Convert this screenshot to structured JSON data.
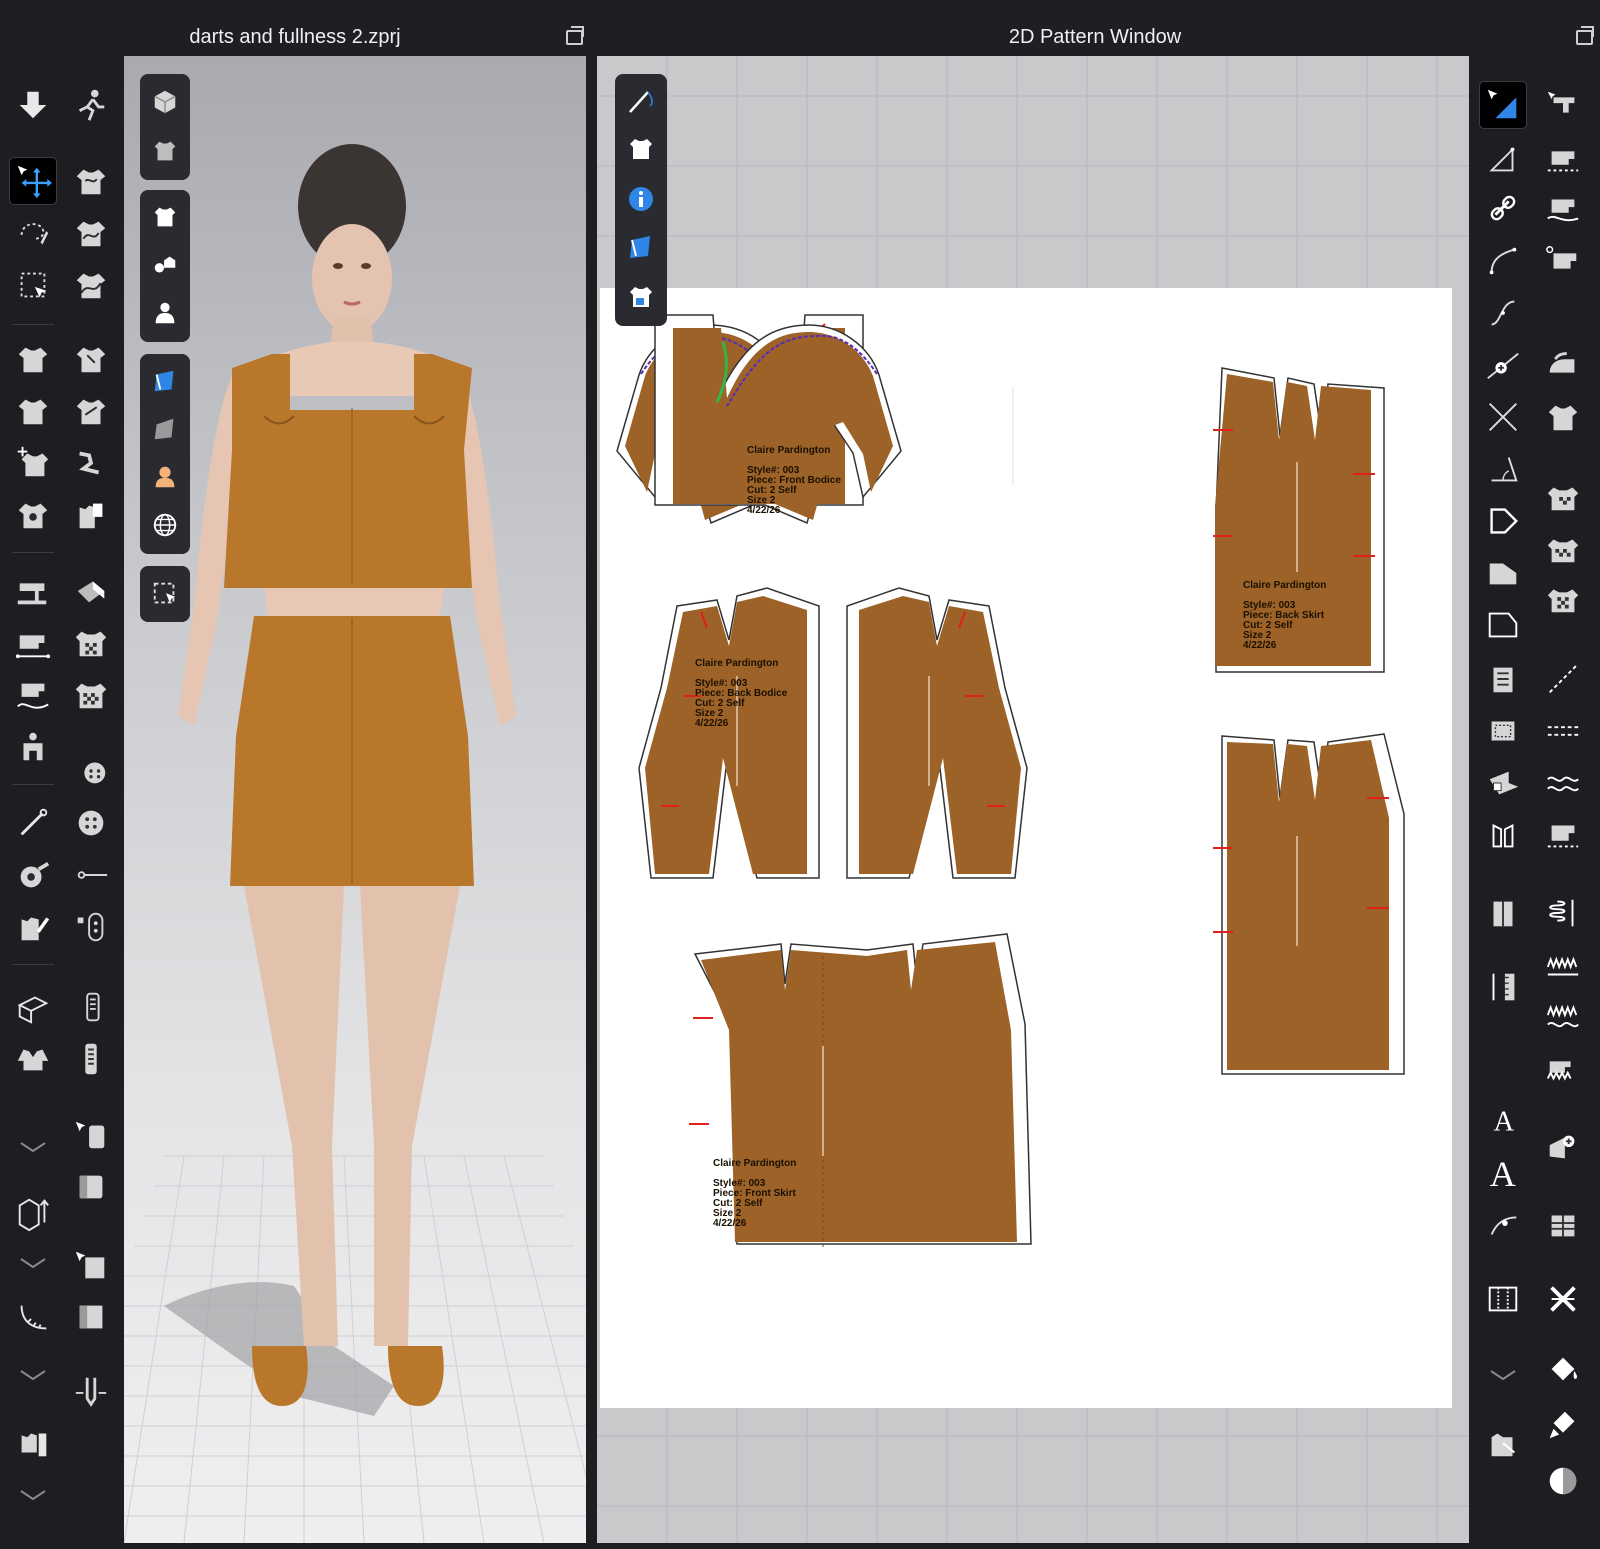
{
  "left_window": {
    "title": "darts and fullness 2.zprj"
  },
  "right_window": {
    "title": "2D Pattern Window"
  },
  "colors": {
    "fabric": "#9c6228",
    "fabric_3d": "#b9772c",
    "seam_purple": "#5a2bb5",
    "seam_green": "#2fb84a",
    "notch_red": "#e0201a",
    "accent_blue": "#2f86e6"
  },
  "patterns": [
    {
      "id": "front-bodice-left",
      "author": "",
      "style": "",
      "piece": "",
      "cut": "",
      "size": "",
      "date": ""
    },
    {
      "id": "front-bodice-right",
      "author": "Claire Pardington",
      "style": "Style#: 003",
      "piece": "Piece: Front Bodice",
      "cut": "Cut: 2 Self",
      "size": "Size 2",
      "date": "4/22/26"
    },
    {
      "id": "back-bodice-left",
      "author": "Claire Pardington",
      "style": "Style#: 003",
      "piece": "Piece: Back Bodice",
      "cut": "Cut: 2 Self",
      "size": "Size 2",
      "date": "4/22/26"
    },
    {
      "id": "back-skirt",
      "author": "Claire Pardington",
      "style": "Style#: 003",
      "piece": "Piece: Back Skirt",
      "cut": "Cut: 2 Self",
      "size": "Size 2",
      "date": "4/22/26"
    },
    {
      "id": "front-skirt",
      "author": "Claire Pardington",
      "style": "Style#: 003",
      "piece": "Piece: Front Skirt",
      "cut": "Cut: 2 Self",
      "size": "Size 2",
      "date": "4/22/26"
    }
  ],
  "left_tools_col1": [
    "download-arrow-icon",
    "transform-move-icon",
    "lasso-select-icon",
    "box-select-icon",
    "garment-fit-icon",
    "garment-shrink-icon",
    "garment-pin-icon",
    "garment-tack-icon",
    "sewing-machine-icon",
    "measure-line-icon",
    "measure-curve-icon",
    "avatar-measure-icon",
    "needle-icon",
    "tape-icon",
    "garment-edit-icon",
    "fold-arrange-icon",
    "jacket-icon",
    "chevron-down-icon",
    "grid-arrow-icon",
    "chevron-down-icon",
    "ruler-arc-icon",
    "chevron-down-icon",
    "shirt-ruler-icon",
    "chevron-down-icon"
  ],
  "left_tools_col2": [
    "walk-pose-icon",
    "shirt-select-icon",
    "shirt-transform-icon",
    "shirt-pin-icon",
    "shirt-fold-icon",
    "shirt-sew-icon",
    "shirt-stretch-icon",
    "shirt-tag-icon",
    "fabric-texture-icon",
    "checker-shirt-icon",
    "checker-shirt-alt-icon",
    "button-select-icon",
    "button-icon",
    "buttonhole-icon",
    "toggle-button-icon",
    "zipper-select-icon",
    "zipper-icon",
    "cylinder-select-icon",
    "cylinder-icon",
    "box-select-alt-icon",
    "box-icon",
    "pin-merge-icon"
  ],
  "viewport_tools": [
    "cube-icon",
    "shirt-3d-icon",
    "shirt-icon",
    "buttons-icon",
    "avatar-icon",
    "blue-fabric-icon",
    "gray-fabric-icon",
    "skin-icon",
    "globe-icon",
    "select-region-icon"
  ],
  "pattern_tools": [
    "needle-thread-icon",
    "shirt-icon",
    "info-icon",
    "blue-fabric-icon",
    "shirt-lock-icon"
  ],
  "right_tools_col1": [
    "pattern-select-icon",
    "polygon-icon",
    "link-icon",
    "curve-point-icon",
    "curvature-icon",
    "add-point-icon",
    "cross-icon",
    "angle-icon",
    "arrow-shape-icon",
    "rect-icon",
    "rect-alt-icon",
    "pleat-icon",
    "dotted-rect-icon",
    "fabric-swatch-icon",
    "symmetry-icon",
    "block-icon",
    "ruler-grid-icon",
    "text-a-icon",
    "text-a-large-icon",
    "arc-measure-icon",
    "grid-lines-icon",
    "chevron-down-icon",
    "shirt-arrow-icon"
  ],
  "right_tools_col2": [
    "pattern-cut-icon",
    "sewing-grid-icon",
    "sewing-fold-icon",
    "sewing-tag-icon",
    "iron-icon",
    "shirt-tshirt-icon",
    "checker-shirt-icon",
    "checker-shirt-alt-icon",
    "checker-dress-icon",
    "dashed-line-icon",
    "dashed-seam-icon",
    "wave-line-icon",
    "sewing-machine-icon",
    "elastic-icon",
    "zigzag-icon",
    "zigzag-seam-icon",
    "wave-seam-icon",
    "add-lens-icon",
    "grid-box-icon",
    "cross-x-icon",
    "paint-bucket-icon",
    "brush-icon",
    "half-circle-icon"
  ]
}
